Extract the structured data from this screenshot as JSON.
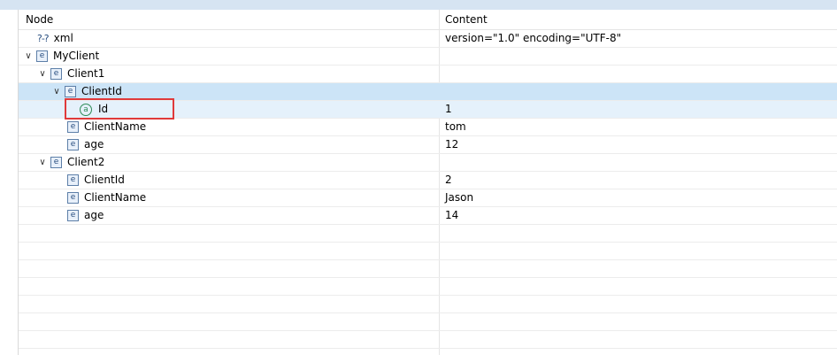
{
  "columns": {
    "node": "Node",
    "content": "Content"
  },
  "rows": [
    {
      "icon": "pi",
      "name": "xml",
      "content": "version=\"1.0\" encoding=\"UTF-8\"",
      "icon_text": "?-?"
    },
    {
      "icon": "e",
      "name": "MyClient",
      "content": "",
      "expanded": true
    },
    {
      "icon": "e",
      "name": "Client1",
      "content": "",
      "expanded": true
    },
    {
      "icon": "e",
      "name": "ClientId",
      "content": "",
      "expanded": true
    },
    {
      "icon": "a",
      "name": "Id",
      "content": "1"
    },
    {
      "icon": "e",
      "name": "ClientName",
      "content": "tom"
    },
    {
      "icon": "e",
      "name": "age",
      "content": "12"
    },
    {
      "icon": "e",
      "name": "Client2",
      "content": "",
      "expanded": true
    },
    {
      "icon": "e",
      "name": "ClientId",
      "content": "2"
    },
    {
      "icon": "e",
      "name": "ClientName",
      "content": "Jason"
    },
    {
      "icon": "e",
      "name": "age",
      "content": "14"
    }
  ],
  "icons": {
    "element": "e",
    "attribute": "a",
    "chevron": "∨"
  },
  "colors": {
    "selection": "#cce4f7",
    "highlight_box": "#e03a3a"
  }
}
